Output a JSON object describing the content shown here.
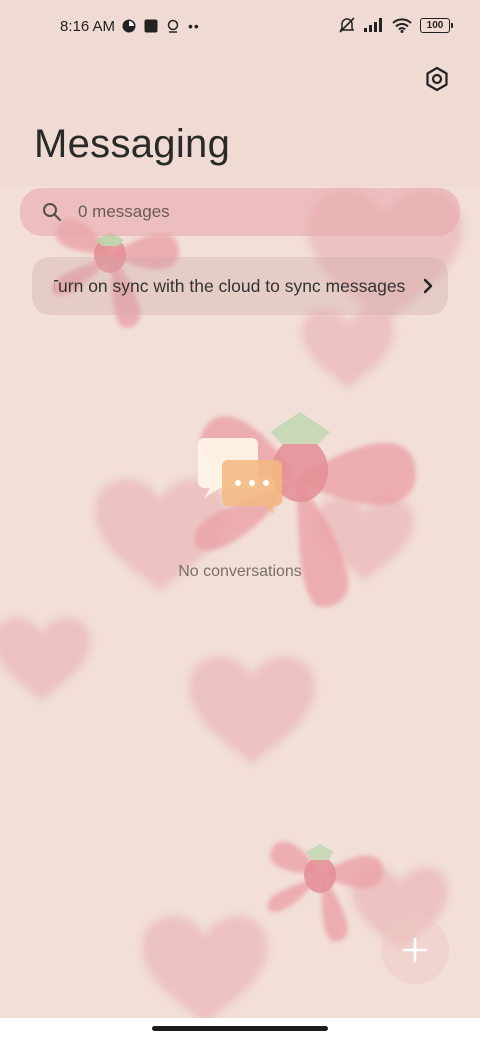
{
  "status_bar": {
    "time": "8:16 AM",
    "battery": "100",
    "icons_left": [
      "app-notification-icon",
      "square-notification-icon",
      "hotspot-icon",
      "more-dots-icon"
    ],
    "icons_right": [
      "mute-icon",
      "signal-icon",
      "wifi-icon",
      "battery-icon"
    ]
  },
  "header": {
    "title": "Messaging",
    "settings_icon": "settings-hexagon-icon"
  },
  "search": {
    "placeholder": "0 messages",
    "icon": "search-icon"
  },
  "sync_banner": {
    "text": "Turn on sync with the cloud to sync messages",
    "icon": "chevron-right-icon"
  },
  "empty_state": {
    "text": "No conversations",
    "icon": "chat-bubbles-icon"
  },
  "fab": {
    "icon": "plus-icon"
  },
  "colors": {
    "background": "#f2dfd7",
    "search_bg": "#e8aaac",
    "bow": "#e9a2a6",
    "heart": "#eab1b2"
  }
}
